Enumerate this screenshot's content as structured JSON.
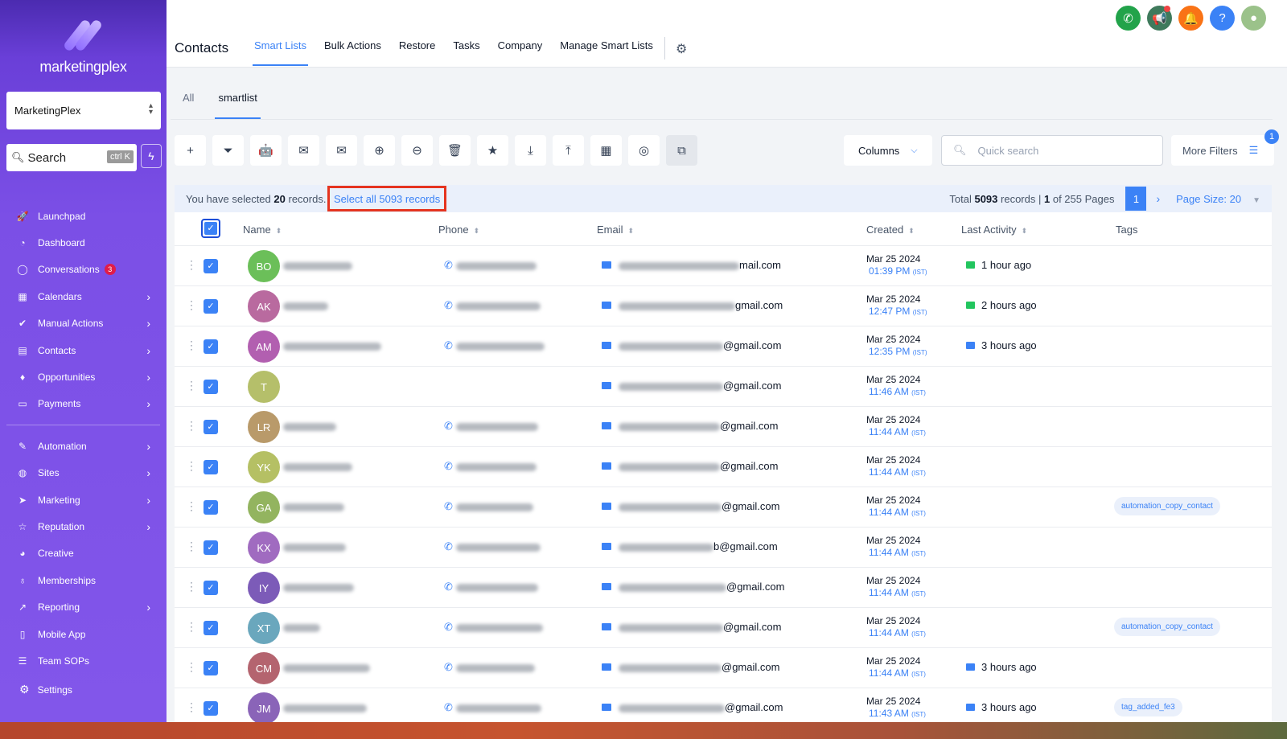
{
  "sidebar": {
    "logo_text": "marketingplex",
    "account_name": "MarketingPlex",
    "search_label": "Search",
    "search_shortcut": "ctrl K",
    "nav_items": [
      {
        "label": "Launchpad",
        "icon": "rocket-icon",
        "has_arrow": false
      },
      {
        "label": "Dashboard",
        "icon": "dashboard-icon",
        "has_arrow": false
      },
      {
        "label": "Conversations",
        "icon": "chat-icon",
        "has_arrow": false,
        "badge": "3"
      },
      {
        "label": "Calendars",
        "icon": "calendar-icon",
        "has_arrow": true
      },
      {
        "label": "Manual Actions",
        "icon": "check-circle-icon",
        "has_arrow": true
      },
      {
        "label": "Contacts",
        "icon": "contacts-icon",
        "has_arrow": true
      },
      {
        "label": "Opportunities",
        "icon": "opportunities-icon",
        "has_arrow": true
      },
      {
        "label": "Payments",
        "icon": "payments-icon",
        "has_arrow": true
      }
    ],
    "nav_items_2": [
      {
        "label": "Automation",
        "icon": "automation-icon",
        "has_arrow": true
      },
      {
        "label": "Sites",
        "icon": "globe-icon",
        "has_arrow": true
      },
      {
        "label": "Marketing",
        "icon": "send-icon",
        "has_arrow": true
      },
      {
        "label": "Reputation",
        "icon": "star-icon",
        "has_arrow": true
      },
      {
        "label": "Creative",
        "icon": "palette-icon",
        "has_arrow": false
      },
      {
        "label": "Memberships",
        "icon": "membership-icon",
        "has_arrow": false
      },
      {
        "label": "Reporting",
        "icon": "chart-icon",
        "has_arrow": true
      },
      {
        "label": "Mobile App",
        "icon": "mobile-icon",
        "has_arrow": false
      },
      {
        "label": "Team SOPs",
        "icon": "list-icon",
        "has_arrow": false
      }
    ],
    "settings_label": "Settings"
  },
  "header": {
    "title": "Contacts",
    "tabs": [
      "Smart Lists",
      "Bulk Actions",
      "Restore",
      "Tasks",
      "Company",
      "Manage Smart Lists"
    ],
    "active_tab": 0,
    "icons": [
      {
        "name": "phone-call-icon",
        "color": "#22a34a",
        "glyph": "✆"
      },
      {
        "name": "announcement-icon",
        "color": "#3f7a5c",
        "glyph": "📢"
      },
      {
        "name": "bell-icon",
        "color": "#f97316",
        "glyph": "🔔"
      },
      {
        "name": "help-icon",
        "color": "#3b82f6",
        "glyph": "?"
      },
      {
        "name": "user-avatar-icon",
        "color": "#9bc28a",
        "glyph": "●"
      }
    ]
  },
  "subtabs": [
    "All",
    "smartlist"
  ],
  "toolbar": {
    "buttons": [
      {
        "name": "add-contact-icon",
        "glyph": "+"
      },
      {
        "name": "filter-icon",
        "glyph": "⏷"
      },
      {
        "name": "automation-bot-icon",
        "glyph": "🤖"
      },
      {
        "name": "sms-icon",
        "glyph": "✉"
      },
      {
        "name": "email-icon",
        "glyph": "✉"
      },
      {
        "name": "add-tag-icon",
        "glyph": "⊕"
      },
      {
        "name": "remove-tag-icon",
        "glyph": "⊖"
      },
      {
        "name": "delete-icon",
        "glyph": "🗑"
      },
      {
        "name": "review-star-icon",
        "glyph": "★"
      },
      {
        "name": "export-icon",
        "glyph": "⤓"
      },
      {
        "name": "import-icon",
        "glyph": "⤒"
      },
      {
        "name": "company-icon",
        "glyph": "▦"
      },
      {
        "name": "whatsapp-icon",
        "glyph": "◎"
      },
      {
        "name": "merge-icon",
        "glyph": "⧉"
      }
    ],
    "columns_label": "Columns",
    "quick_search_placeholder": "Quick search",
    "more_filters_label": "More Filters",
    "more_filters_count": "1"
  },
  "selection": {
    "prefix": "You have selected",
    "count": "20",
    "suffix": "records.",
    "select_all_label": "Select all 5093 records"
  },
  "pagination": {
    "total_prefix": "Total",
    "total": "5093",
    "records_sep": "records |",
    "current": "1",
    "of_pages": "of 255 Pages",
    "page_button": "1",
    "page_size_label": "Page Size: 20"
  },
  "table": {
    "columns": {
      "name": "Name",
      "phone": "Phone",
      "email": "Email",
      "created": "Created",
      "last_activity": "Last Activity",
      "tags": "Tags"
    },
    "rows": [
      {
        "initials": "BO",
        "color": "#6bbf59",
        "name_w": 86,
        "phone": true,
        "phone_w": 100,
        "email_tail": "mail.com",
        "email_w": 150,
        "date": "Mar 25 2024",
        "time": "01:39 PM",
        "ist": "(IST)",
        "activity": "1 hour ago",
        "activity_type": "msg",
        "tag": ""
      },
      {
        "initials": "AK",
        "color": "#b96a9f",
        "name_w": 56,
        "phone": true,
        "phone_w": 105,
        "email_tail": "gmail.com",
        "email_w": 145,
        "date": "Mar 25 2024",
        "time": "12:47 PM",
        "ist": "(IST)",
        "activity": "2 hours ago",
        "activity_type": "msg",
        "tag": ""
      },
      {
        "initials": "AM",
        "color": "#b25fb0",
        "name_w": 122,
        "phone": true,
        "phone_w": 110,
        "email_tail": "@gmail.com",
        "email_w": 130,
        "date": "Mar 25 2024",
        "time": "12:35 PM",
        "ist": "(IST)",
        "activity": "3 hours ago",
        "activity_type": "mail",
        "tag": ""
      },
      {
        "initials": "T",
        "color": "#b5bf6a",
        "name_w": 0,
        "phone": false,
        "phone_w": 0,
        "email_tail": "@gmail.com",
        "email_w": 130,
        "date": "Mar 25 2024",
        "time": "11:46 AM",
        "ist": "(IST)",
        "activity": "",
        "activity_type": "",
        "tag": ""
      },
      {
        "initials": "LR",
        "color": "#b99a6a",
        "name_w": 66,
        "phone": true,
        "phone_w": 102,
        "email_tail": "@gmail.com",
        "email_w": 126,
        "date": "Mar 25 2024",
        "time": "11:44 AM",
        "ist": "(IST)",
        "activity": "",
        "activity_type": "",
        "tag": ""
      },
      {
        "initials": "YK",
        "color": "#b5c064",
        "name_w": 86,
        "phone": true,
        "phone_w": 100,
        "email_tail": "@gmail.com",
        "email_w": 126,
        "date": "Mar 25 2024",
        "time": "11:44 AM",
        "ist": "(IST)",
        "activity": "",
        "activity_type": "",
        "tag": ""
      },
      {
        "initials": "GA",
        "color": "#93b45f",
        "name_w": 76,
        "phone": true,
        "phone_w": 96,
        "email_tail": "@gmail.com",
        "email_w": 128,
        "date": "Mar 25 2024",
        "time": "11:44 AM",
        "ist": "(IST)",
        "activity": "",
        "activity_type": "",
        "tag": "automation_copy_contact"
      },
      {
        "initials": "KX",
        "color": "#a06bc0",
        "name_w": 78,
        "phone": true,
        "phone_w": 105,
        "email_tail": "b@gmail.com",
        "email_w": 118,
        "date": "Mar 25 2024",
        "time": "11:44 AM",
        "ist": "(IST)",
        "activity": "",
        "activity_type": "",
        "tag": ""
      },
      {
        "initials": "IY",
        "color": "#7c5bb8",
        "name_w": 88,
        "phone": true,
        "phone_w": 102,
        "email_tail": "@gmail.com",
        "email_w": 134,
        "date": "Mar 25 2024",
        "time": "11:44 AM",
        "ist": "(IST)",
        "activity": "",
        "activity_type": "",
        "tag": ""
      },
      {
        "initials": "XT",
        "color": "#6aa7bd",
        "name_w": 46,
        "phone": true,
        "phone_w": 108,
        "email_tail": "@gmail.com",
        "email_w": 130,
        "date": "Mar 25 2024",
        "time": "11:44 AM",
        "ist": "(IST)",
        "activity": "",
        "activity_type": "",
        "tag": "automation_copy_contact"
      },
      {
        "initials": "CM",
        "color": "#b4646f",
        "name_w": 108,
        "phone": true,
        "phone_w": 98,
        "email_tail": "@gmail.com",
        "email_w": 128,
        "date": "Mar 25 2024",
        "time": "11:44 AM",
        "ist": "(IST)",
        "activity": "3 hours ago",
        "activity_type": "mail",
        "tag": ""
      },
      {
        "initials": "JM",
        "color": "#8a64b8",
        "name_w": 104,
        "phone": true,
        "phone_w": 106,
        "email_tail": "@gmail.com",
        "email_w": 132,
        "date": "Mar 25 2024",
        "time": "11:43 AM",
        "ist": "(IST)",
        "activity": "3 hours ago",
        "activity_type": "mail",
        "tag": "tag_added_fe3"
      }
    ]
  }
}
